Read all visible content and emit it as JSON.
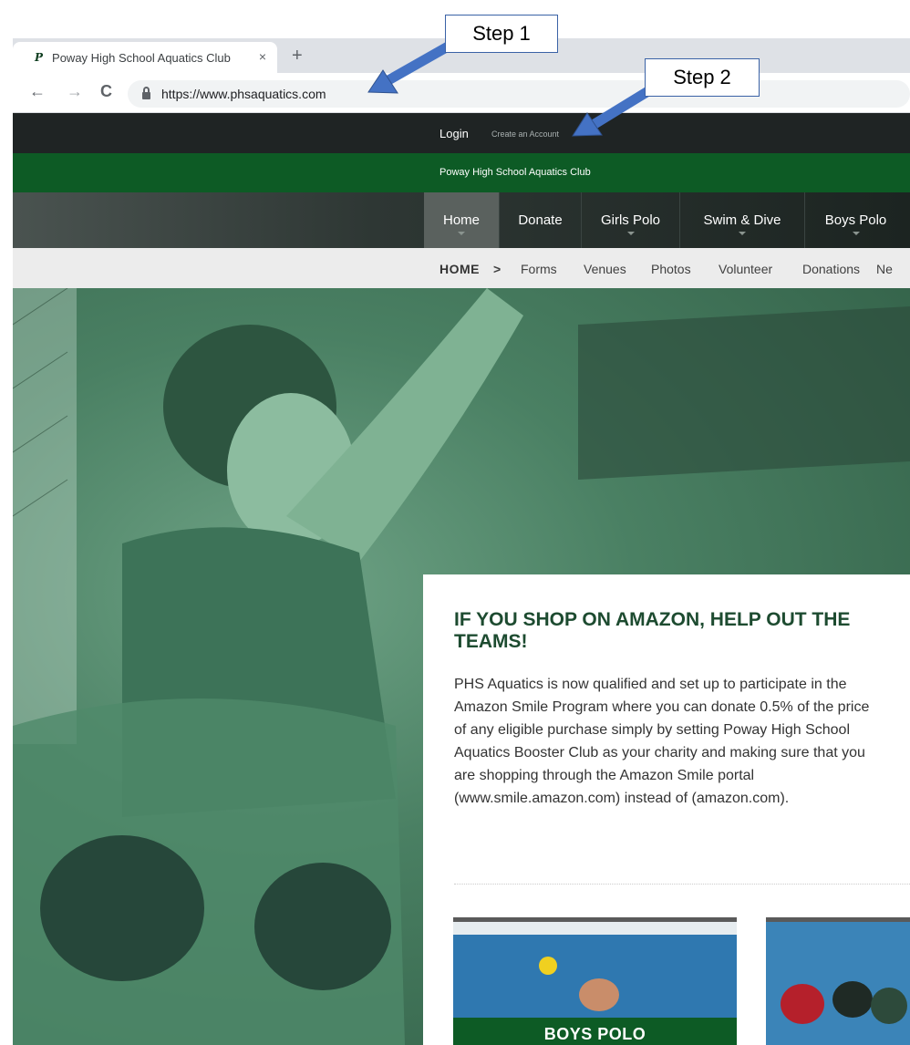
{
  "browser": {
    "tab_title": "Poway High School Aquatics Club",
    "tab_favicon": "P",
    "close_glyph": "×",
    "new_tab_glyph": "+",
    "back_glyph": "←",
    "forward_glyph": "→",
    "reload_glyph": "C",
    "url": "https://www.phsaquatics.com"
  },
  "site": {
    "login": "Login",
    "create_account": "Create an Account",
    "club_name": "Poway High School Aquatics Club",
    "nav": [
      "Home",
      "Donate",
      "Girls Polo",
      "Swim & Dive",
      "Boys Polo"
    ],
    "sub_nav": {
      "home": "HOME",
      "separator": ">",
      "items": [
        "Forms",
        "Venues",
        "Photos",
        "Volunteer",
        "Donations",
        "Ne"
      ]
    }
  },
  "content": {
    "title": "IF YOU SHOP ON AMAZON, HELP OUT THE TEAMS!",
    "body": "PHS Aquatics is now qualified and set up to participate in the Amazon Smile Program where you can donate 0.5% of the price of any eligible purchase simply by setting Poway High School Aquatics Booster Club as your charity and making sure that you are shopping through the Amazon Smile portal (www.smile.amazon.com) instead of (amazon.com).",
    "promo_boys": "BOYS POLO"
  },
  "callouts": {
    "step1": "Step 1",
    "step2": "Step 2"
  },
  "colors": {
    "club_green": "#0d5b25",
    "heading_green": "#1d4b30",
    "callout_blue": "#4472c4"
  }
}
